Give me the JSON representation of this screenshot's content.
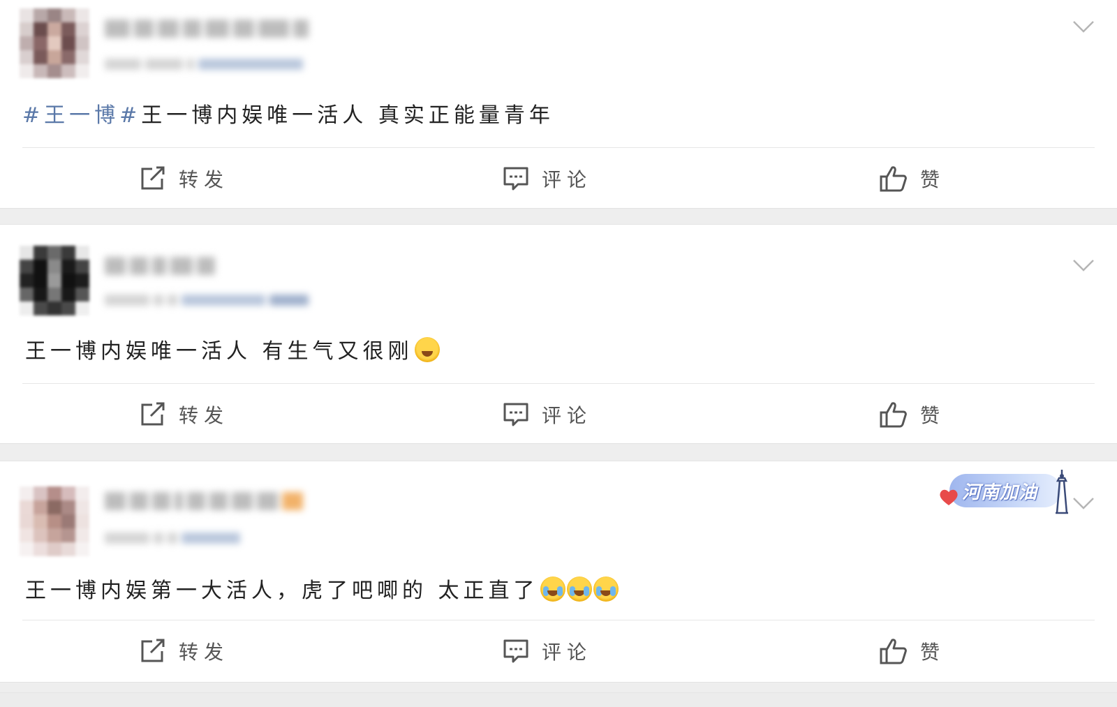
{
  "posts": [
    {
      "segments": [
        {
          "text": "#王一博#",
          "kind": "hashtag"
        },
        {
          "text": "王一博内娱唯一活人 真实正能量青年",
          "kind": "plain"
        }
      ],
      "emojis": []
    },
    {
      "segments": [
        {
          "text": "王一博内娱唯一活人 有生气又很刚",
          "kind": "plain"
        }
      ],
      "emojis": [
        "blush-emoji"
      ]
    },
    {
      "segments": [
        {
          "text": "王一博内娱第一大活人，虎了吧唧的 太正直了",
          "kind": "plain"
        }
      ],
      "emojis": [
        "laugh-cry-emoji",
        "laugh-cry-emoji",
        "laugh-cry-emoji"
      ],
      "badge": "河南加油"
    }
  ],
  "actions": {
    "repost_label": "转发",
    "comment_label": "评论",
    "like_label": "赞"
  },
  "colors": {
    "hashtag": "#5a78a8",
    "text": "#222222",
    "action_text": "#555555",
    "divider": "#e6e6e6",
    "gap": "#eeeeee"
  },
  "icons": {
    "menu": "chevron-down-icon",
    "repost": "share-icon",
    "comment": "comment-icon",
    "like": "thumbs-up-icon"
  }
}
